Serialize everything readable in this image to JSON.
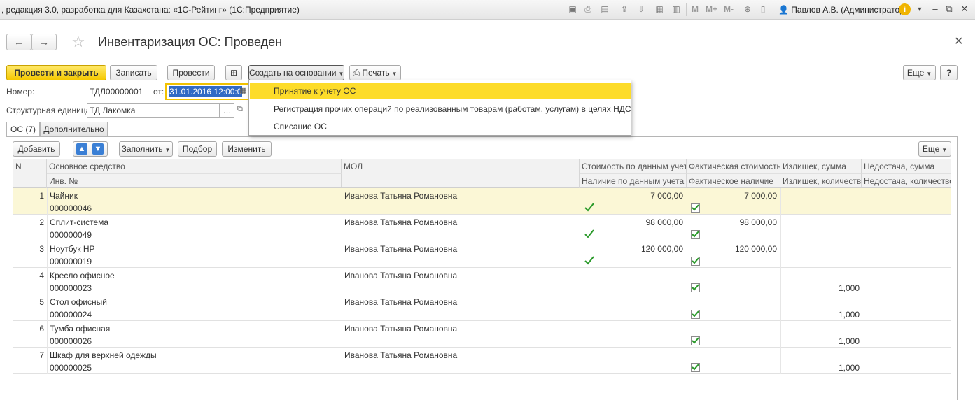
{
  "window": {
    "title": ", редакция 3.0, разработка для Казахстана: «1С-Рейтинг» (1С:Предприятие)",
    "user": "Павлов А.В. (Администратор)",
    "toolbar_m": [
      "M",
      "M+",
      "M-"
    ]
  },
  "header": {
    "title": "Инвентаризация ОС: Проведен"
  },
  "toolbar": {
    "post_close": "Провести и закрыть",
    "save": "Записать",
    "post": "Провести",
    "create_based": "Создать на основании",
    "print": "Печать",
    "more": "Еще",
    "help": "?"
  },
  "form": {
    "number_label": "Номер:",
    "number_value": "ТДЛ00000001",
    "date_label": "от:",
    "date_value": "31.01.2016 12:00:0",
    "unit_label": "Структурная единица:",
    "unit_value": "ТД Лакомка"
  },
  "dropdown": {
    "items": [
      "Принятие к учету ОС",
      "Регистрация прочих операций по реализованным товарам (работам, услугам) в целях НДС",
      "Списание ОС"
    ]
  },
  "tabs": [
    "ОС (7)",
    "Дополнительно"
  ],
  "table_toolbar": {
    "add": "Добавить",
    "fill": "Заполнить",
    "select": "Подбор",
    "edit": "Изменить",
    "more": "Еще"
  },
  "table": {
    "headers_top": [
      "N",
      "Основное средство",
      "МОЛ",
      "Стоимость по данным учета",
      "Фактическая стоимость",
      "Излишек, сумма",
      "Недостача, сумма"
    ],
    "headers_bottom": [
      "Инв. №",
      "Наличие по данным учета",
      "Фактическое наличие",
      "Излишек, количество",
      "Недостача, количество"
    ],
    "rows": [
      {
        "n": "1",
        "name": "Чайник",
        "inv": "000000046",
        "mol": "Иванова Татьяна Романовна",
        "cost": "7 000,00",
        "fact_cost": "7 000,00",
        "in_acc": true,
        "fact": true,
        "surplus_qty": ""
      },
      {
        "n": "2",
        "name": "Сплит-система",
        "inv": "000000049",
        "mol": "Иванова Татьяна Романовна",
        "cost": "98 000,00",
        "fact_cost": "98 000,00",
        "in_acc": true,
        "fact": true,
        "surplus_qty": ""
      },
      {
        "n": "3",
        "name": "Ноутбук HP",
        "inv": "000000019",
        "mol": "Иванова Татьяна Романовна",
        "cost": "120 000,00",
        "fact_cost": "120 000,00",
        "in_acc": true,
        "fact": true,
        "surplus_qty": ""
      },
      {
        "n": "4",
        "name": "Кресло офисное",
        "inv": "000000023",
        "mol": "Иванова Татьяна Романовна",
        "cost": "",
        "fact_cost": "",
        "in_acc": false,
        "fact": true,
        "surplus_qty": "1,000"
      },
      {
        "n": "5",
        "name": "Стол офисный",
        "inv": "000000024",
        "mol": "Иванова Татьяна Романовна",
        "cost": "",
        "fact_cost": "",
        "in_acc": false,
        "fact": true,
        "surplus_qty": "1,000"
      },
      {
        "n": "6",
        "name": "Тумба офисная",
        "inv": "000000026",
        "mol": "Иванова Татьяна Романовна",
        "cost": "",
        "fact_cost": "",
        "in_acc": false,
        "fact": true,
        "surplus_qty": "1,000"
      },
      {
        "n": "7",
        "name": "Шкаф для верхней одежды",
        "inv": "000000025",
        "mol": "Иванова Татьяна Романовна",
        "cost": "",
        "fact_cost": "",
        "in_acc": false,
        "fact": true,
        "surplus_qty": "1,000"
      }
    ]
  },
  "colors": {
    "accent_yellow": "#fddc2a",
    "current_row": "#fbf7d6",
    "check_green": "#2a9a2a",
    "selection_blue": "#316ac5"
  }
}
